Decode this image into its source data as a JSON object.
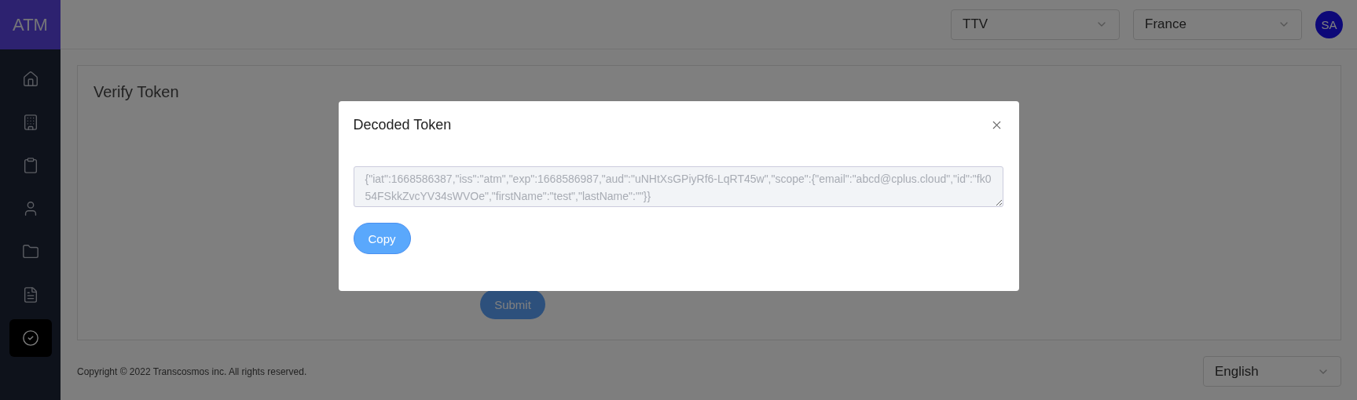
{
  "sidebar": {
    "logo": "ATM",
    "items": [
      {
        "selected": false
      },
      {
        "selected": false
      },
      {
        "selected": false
      },
      {
        "selected": false
      },
      {
        "selected": false
      },
      {
        "selected": false
      },
      {
        "selected": true
      }
    ]
  },
  "header": {
    "selects": [
      "TTV",
      "France"
    ],
    "avatar": "SA"
  },
  "page": {
    "title": "Verify Token",
    "submit": "Submit"
  },
  "footer": {
    "copyright": "Copyright © 2022 Transcosmos inc. All rights reserved.",
    "language": "English"
  },
  "modal": {
    "title": "Decoded Token",
    "token": "{\"iat\":1668586387,\"iss\":\"atm\",\"exp\":1668586987,\"aud\":\"uNHtXsGPiyRf6-LqRT45w\",\"scope\":{\"email\":\"abcd@cplus.cloud\",\"id\":\"fk054FSkkZvcYV34sWVOe\",\"firstName\":\"test\",\"lastName\":\"\"}}",
    "copy": "Copy"
  }
}
